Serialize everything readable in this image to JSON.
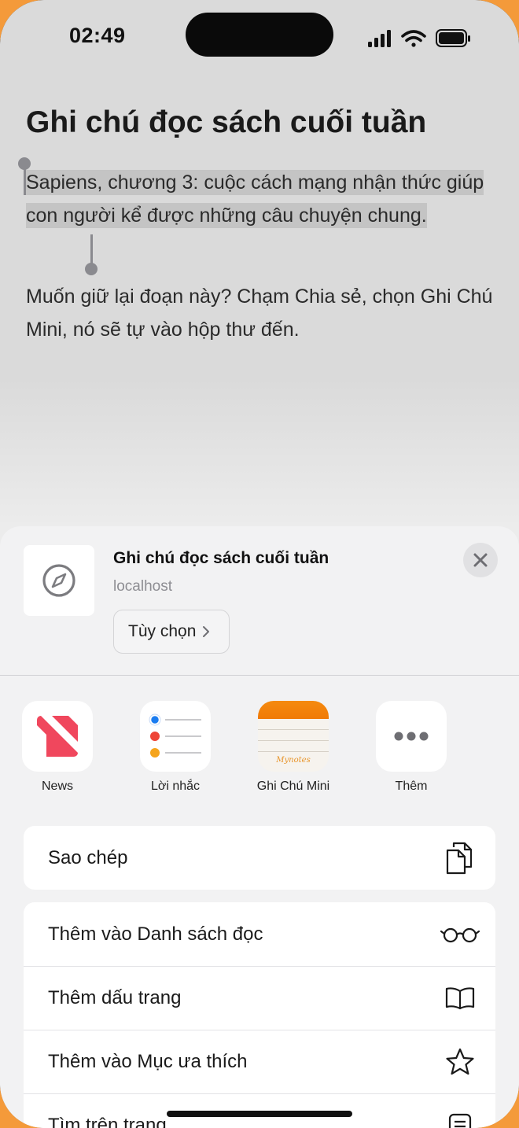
{
  "status_bar": {
    "time": "02:49"
  },
  "document": {
    "title": "Ghi chú đọc sách cuối tuần",
    "selected_paragraph": "Sapiens, chương 3: cuộc cách mạng nhận thức giúp con người kể được những câu chuyện chung.",
    "paragraph_2": "Muốn giữ lại đoạn này? Chạm Chia sẻ, chọn Ghi Chú Mini, nó sẽ tự vào hộp thư đến."
  },
  "share_sheet": {
    "title": "Ghi chú đọc sách cuối tuần",
    "subtitle": "localhost",
    "options_label": "Tùy chọn",
    "apps": [
      {
        "label": "News",
        "icon": "news-icon"
      },
      {
        "label": "Lời nhắc",
        "icon": "reminders-icon"
      },
      {
        "label": "Ghi Chú Mini",
        "icon": "mini-notes-icon",
        "icon_text": "Mynotes"
      },
      {
        "label": "Thêm",
        "icon": "more-icon"
      }
    ],
    "action_copy": "Sao chép",
    "actions": [
      {
        "label": "Thêm vào Danh sách đọc",
        "icon": "glasses-icon"
      },
      {
        "label": "Thêm dấu trang",
        "icon": "book-icon"
      },
      {
        "label": "Thêm vào Mục ưa thích",
        "icon": "star-icon"
      },
      {
        "label": "Tìm trên trang",
        "icon": "find-icon"
      }
    ]
  },
  "colors": {
    "accent_orange": "#f49a3a",
    "news_red": "#f0475d",
    "selection": "#c4c4c4"
  }
}
